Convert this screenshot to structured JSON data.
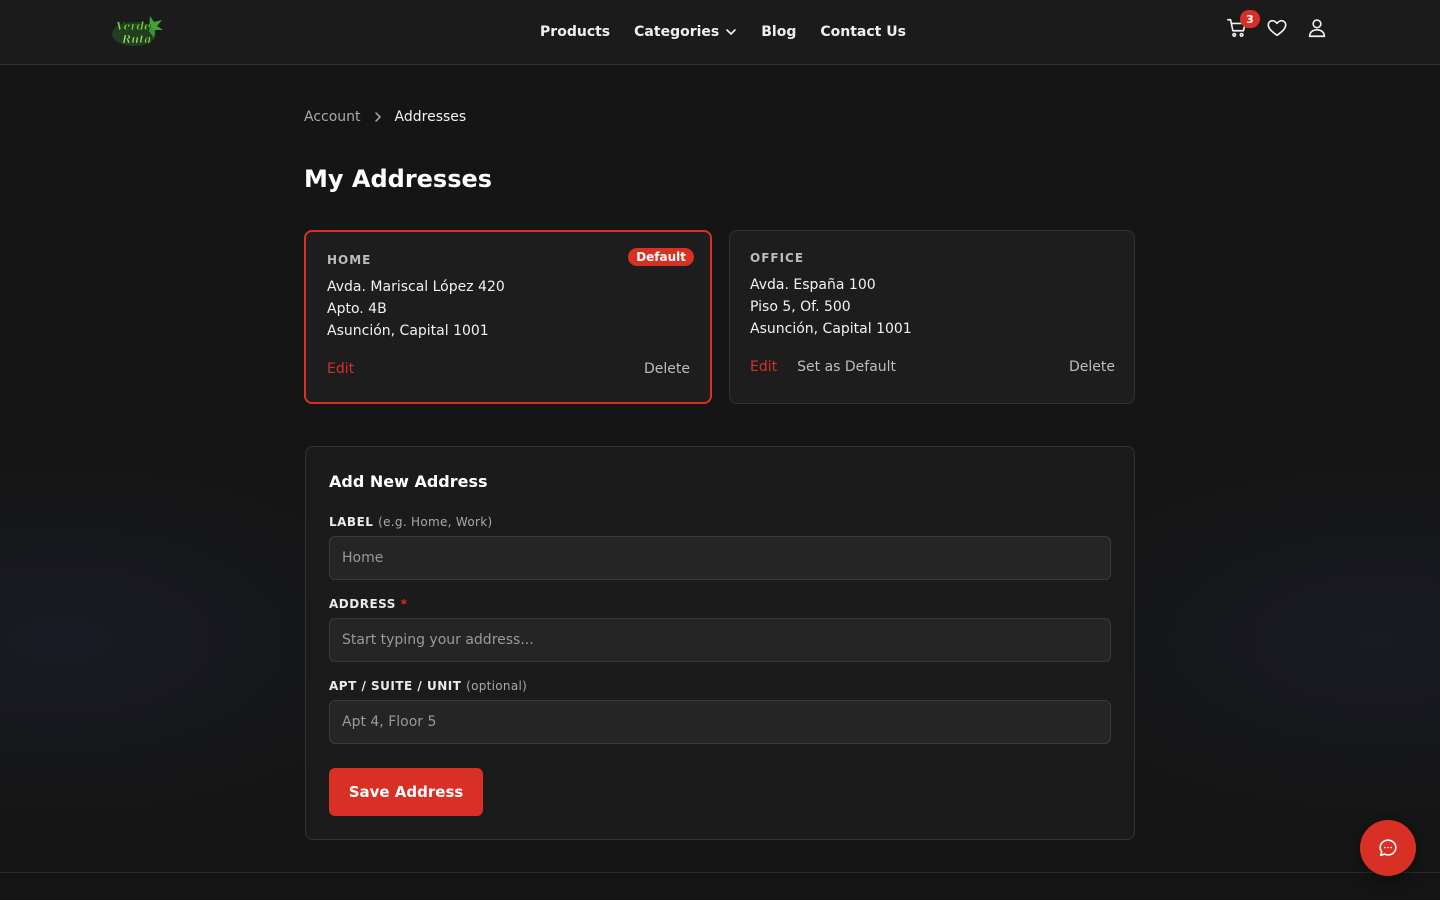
{
  "header": {
    "logo_text": "Verde Ruta",
    "nav": [
      {
        "label": "Products"
      },
      {
        "label": "Categories"
      },
      {
        "label": "Blog"
      },
      {
        "label": "Contact Us"
      }
    ],
    "cart_count": "3",
    "icons": [
      "cart-icon",
      "heart-icon",
      "user-icon"
    ]
  },
  "breadcrumb": {
    "parent": "Account",
    "current": "Addresses"
  },
  "page_title": "My Addresses",
  "addresses": [
    {
      "label": "HOME",
      "badge": "Default",
      "lines": [
        "Avda. Mariscal López 420",
        "Apto. 4B",
        "Asunción, Capital 1001"
      ],
      "edit": "Edit",
      "delete": "Delete"
    },
    {
      "label": "OFFICE",
      "lines": [
        "Avda. España 100",
        "Piso 5, Of. 500",
        "Asunción, Capital 1001"
      ],
      "edit": "Edit",
      "set_default": "Set as Default",
      "delete": "Delete"
    }
  ],
  "form": {
    "title": "Add New Address",
    "label_field": {
      "label": "LABEL",
      "hint": "(e.g. Home, Work)",
      "placeholder": "Home"
    },
    "address_field": {
      "label": "ADDRESS",
      "required": "*",
      "placeholder": "Start typing your address..."
    },
    "apt_field": {
      "label": "APT / SUITE / UNIT",
      "hint": "(optional)",
      "placeholder": "Apt 4, Floor 5"
    },
    "save_label": "Save Address"
  },
  "colors": {
    "accent": "#d93025",
    "background": "#151515",
    "card": "#1d1d1d"
  }
}
